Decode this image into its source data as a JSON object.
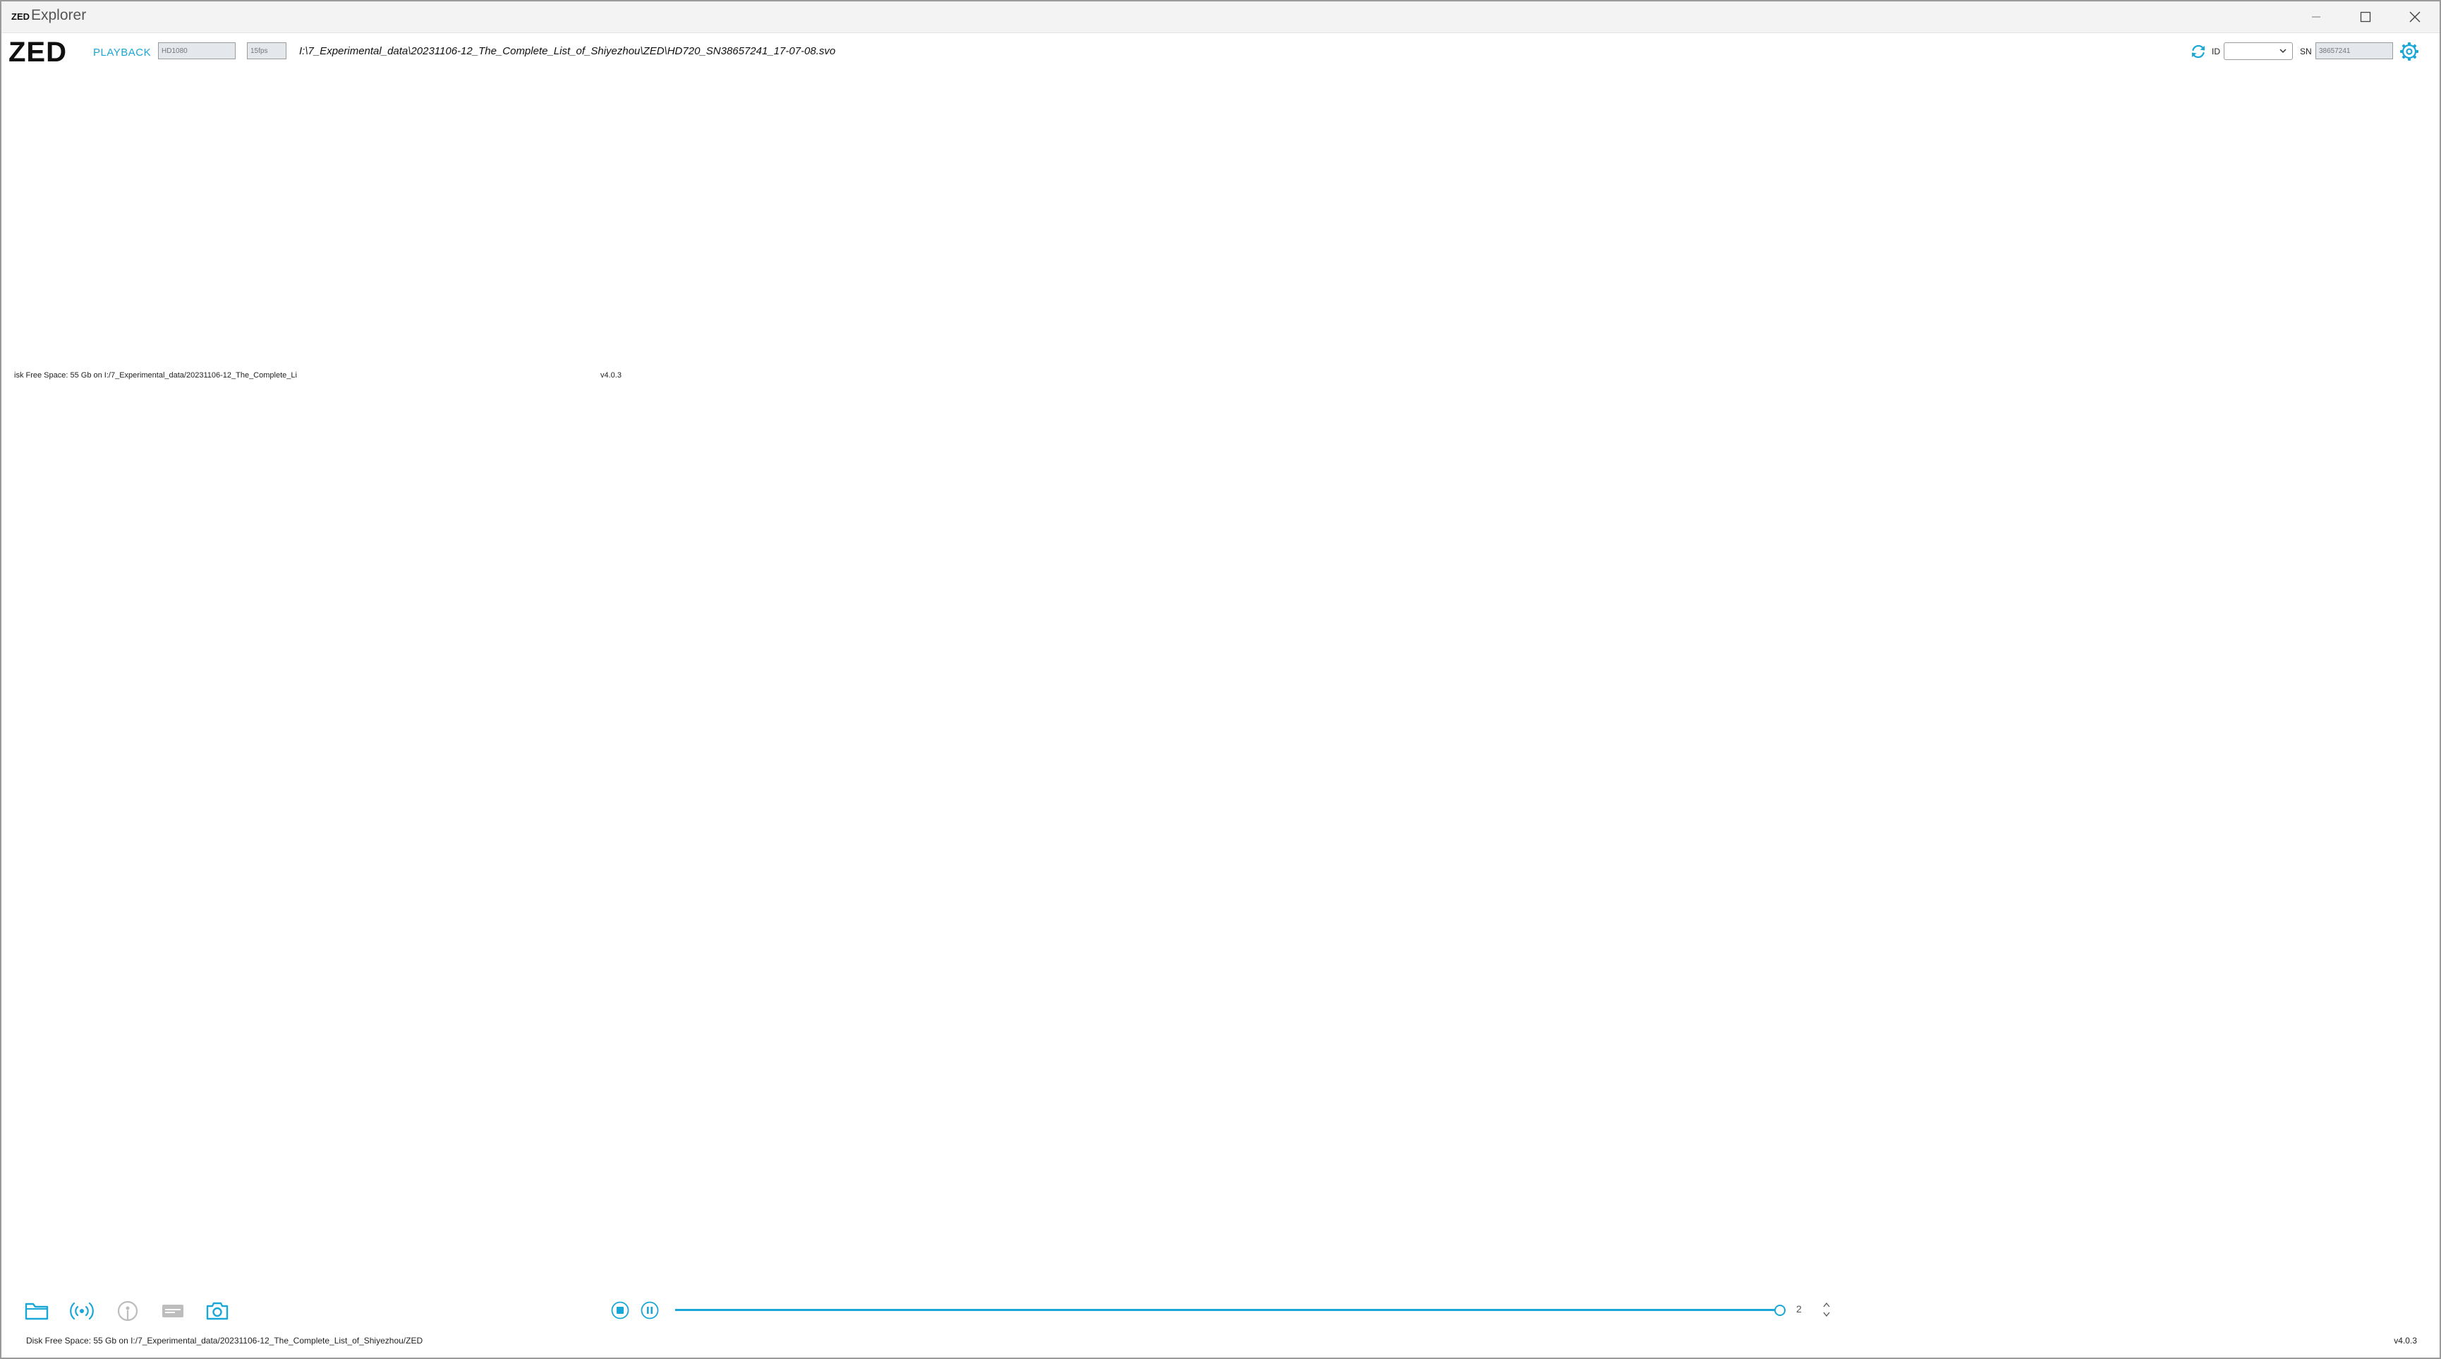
{
  "window": {
    "logo": "ZED",
    "title": "Explorer"
  },
  "toolbar": {
    "logo": "ZED",
    "mode": "PLAYBACK",
    "resolution_placeholder": "HD1080",
    "fps_placeholder": "15fps",
    "file_path": "I:\\7_Experimental_data\\20231106-12_The_Complete_List_of_Shiyezhou\\ZED\\HD720_SN38657241_17-07-08.svo",
    "id_label": "ID",
    "id_value": "",
    "sn_label": "SN",
    "sn_placeholder": "38657241"
  },
  "viewport": {
    "status_text": "isk Free Space: 55 Gb  on I:/7_Experimental_data/20231106-12_The_Complete_Li",
    "version": "v4.0.3"
  },
  "playback": {
    "progress": 1.0,
    "frame_value": "2"
  },
  "statusbar": {
    "text": "Disk Free Space: 55 Gb  on I:/7_Experimental_data/20231106-12_The_Complete_List_of_Shiyezhou/ZED",
    "version": "v4.0.3"
  },
  "icons": {
    "refresh": "refresh-icon",
    "settings": "gear-icon",
    "open": "folder-icon",
    "stream": "broadcast-icon",
    "record": "record-icon",
    "export": "export-icon",
    "snapshot": "camera-icon",
    "stop": "stop-icon",
    "pause": "pause-icon"
  },
  "colors": {
    "accent": "#19a7d8",
    "disabled": "#b8b8b8",
    "text": "#222222",
    "border": "#9a9a9a"
  }
}
